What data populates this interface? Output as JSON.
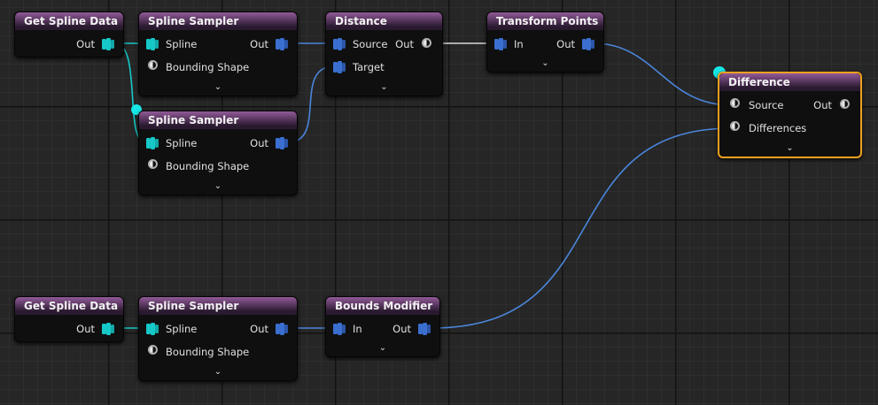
{
  "colors": {
    "accent_cyan": "#16e6e6",
    "wire_blue": "#4a86dc",
    "wire_white": "#d8d8d8",
    "header_purple": "#925a98",
    "selected_outline": "#f0a020"
  },
  "nodes": {
    "get_spline_1": {
      "title": "Get Spline Data",
      "out": "Out"
    },
    "sampler_1": {
      "title": "Spline Sampler",
      "in_spline": "Spline",
      "in_bounds": "Bounding Shape",
      "out": "Out"
    },
    "sampler_2": {
      "title": "Spline Sampler",
      "in_spline": "Spline",
      "in_bounds": "Bounding Shape",
      "out": "Out"
    },
    "distance": {
      "title": "Distance",
      "in_source": "Source",
      "in_target": "Target",
      "out": "Out"
    },
    "transform": {
      "title": "Transform Points",
      "in": "In",
      "out": "Out"
    },
    "difference": {
      "title": "Difference",
      "in_source": "Source",
      "in_diff": "Differences",
      "out": "Out"
    },
    "get_spline_2": {
      "title": "Get Spline Data",
      "out": "Out"
    },
    "sampler_3": {
      "title": "Spline Sampler",
      "in_spline": "Spline",
      "in_bounds": "Bounding Shape",
      "out": "Out"
    },
    "bounds_mod": {
      "title": "Bounds Modifier",
      "in": "In",
      "out": "Out"
    }
  },
  "icons": {
    "expand": "chevron-down-icon",
    "spatial_pin": "stacked-data-icon",
    "point_pin": "circle-pin-icon"
  }
}
